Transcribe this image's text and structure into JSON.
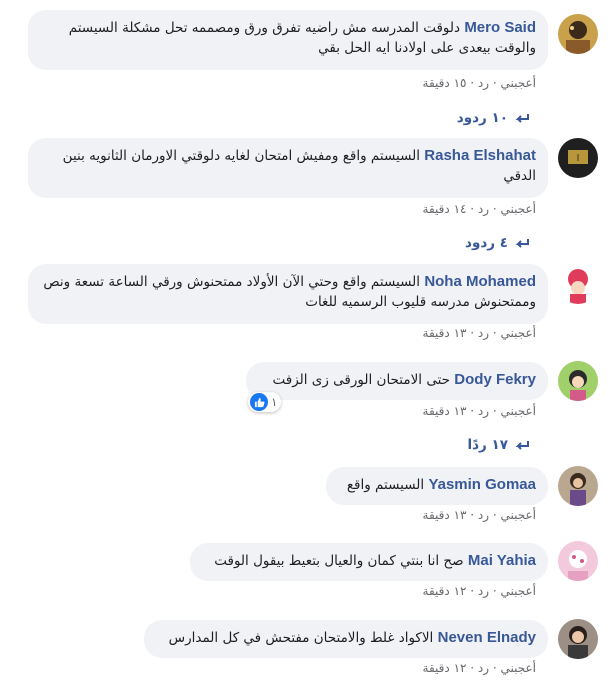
{
  "comments": [
    {
      "author": "Mero Said",
      "text": "دلوقت المدرسه مش راضيه تفرق ورق ومصممه تحل مشكلة السيستم والوقت بيعدى على اولادنا ايه الحل بقي",
      "like": "أعجبني",
      "reply": "رد",
      "time": "١٥ دقيقة",
      "replies_label": "١٠ ردود"
    },
    {
      "author": "Rasha Elshahat",
      "text": "السيستم واقع ومفيش امتحان لغايه دلوقتي الاورمان الثانويه بنين الدقي",
      "like": "أعجبني",
      "reply": "رد",
      "time": "١٤ دقيقة",
      "replies_label": "٤ ردود"
    },
    {
      "author": "Noha Mohamed",
      "text": "السيستم واقع وحتي الآن الأولاد ممتحنوش ورقي الساعة تسعة ونص وممتحنوش مدرسه قليوب الرسميه للغات",
      "like": "أعجبني",
      "reply": "رد",
      "time": "١٣ دقيقة"
    },
    {
      "author": "Dody Fekry",
      "text": "حتى الامتحان الورقى زى الزفت",
      "reaction_count": "١",
      "like": "أعجبني",
      "reply": "رد",
      "time": "١٣ دقيقة",
      "replies_label": "١٧ ردًا"
    },
    {
      "author": "Yasmin Gomaa",
      "text": "السيستم واقع",
      "like": "أعجبني",
      "reply": "رد",
      "time": "١٣ دقيقة"
    },
    {
      "author": "Mai Yahia",
      "text": "صح انا بنتي كمان والعيال بتعيط بيقول الوقت",
      "like": "أعجبني",
      "reply": "رد",
      "time": "١٢ دقيقة"
    },
    {
      "author": "Neven Elnady",
      "text": "الاكواد غلط والامتحان مفتحش في كل المدارس",
      "like": "أعجبني",
      "reply": "رد",
      "time": "١٢ دقيقة"
    }
  ],
  "colors": {
    "link": "#385898",
    "bubble": "#f0f2f5",
    "meta": "#65676b",
    "like": "#1877f2"
  },
  "icons": {
    "reply": "reply-arrow-icon",
    "like": "like-thumb-icon"
  }
}
